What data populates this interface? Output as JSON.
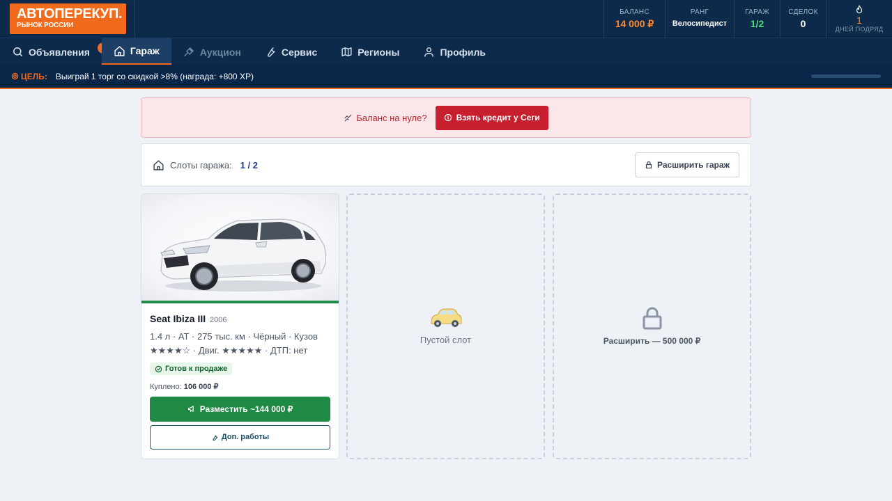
{
  "header": {
    "logo_title": "АВТОПЕРЕКУП.",
    "logo_subtitle": "РЫНОК РОССИИ",
    "stats": {
      "balance_label": "БАЛАНС",
      "balance_value": "14 000 ₽",
      "rank_label": "РАНГ",
      "rank_value": "Велосипедист",
      "garage_label": "ГАРАЖ",
      "garage_value": "1/2",
      "deals_label": "СДЕЛОК",
      "deals_value": "0",
      "streak_value": "1",
      "streak_label": "ДНЕЙ ПОДРЯД",
      "streak_icon": "flame-icon"
    },
    "colors": {
      "brand_orange": "#f26a1b",
      "header_bg": "#0d2a4a",
      "positive_green": "#4ade80"
    }
  },
  "nav": {
    "items": [
      {
        "label": "Объявления",
        "icon": "search-icon",
        "badge": "6"
      },
      {
        "label": "Гараж",
        "icon": "home-icon",
        "active": true
      },
      {
        "label": "Аукцион",
        "icon": "gavel-icon",
        "disabled": true
      },
      {
        "label": "Сервис",
        "icon": "wrench-icon"
      },
      {
        "label": "Регионы",
        "icon": "map-icon"
      },
      {
        "label": "Профиль",
        "icon": "user-icon"
      }
    ]
  },
  "goal": {
    "tag": "ЦЕЛЬ:",
    "text": "Выиграй 1 торг со скидкой >8% (награда: +800 XP)",
    "progress": 0
  },
  "alert": {
    "text": "Баланс на нуле?",
    "button_label": "Взять кредит у Сеги"
  },
  "slots": {
    "label": "Слоты гаража:",
    "count": "1 / 2",
    "expand_button_label": "Расширить гараж"
  },
  "car_card": {
    "name": "Seat Ibiza III",
    "year": "2006",
    "spec_line1": "1.4 л · АТ · 275 тыс. км · Чёрный · Кузов",
    "spec_line2": "★★★★☆ · Двиг. ★★★★★ · ДТП: нет",
    "status": "Готов к продаже",
    "bought_label": "Куплено:",
    "bought_value": "106 000 ₽",
    "place_button_label": "Разместить ~144 000 ₽",
    "works_button_label": "Доп. работы"
  },
  "empty_slot": {
    "label": "Пустой слот",
    "icon": "retro-car-icon"
  },
  "locked_slot": {
    "label": "Расширить — 500 000 ₽",
    "icon": "lock-icon"
  }
}
